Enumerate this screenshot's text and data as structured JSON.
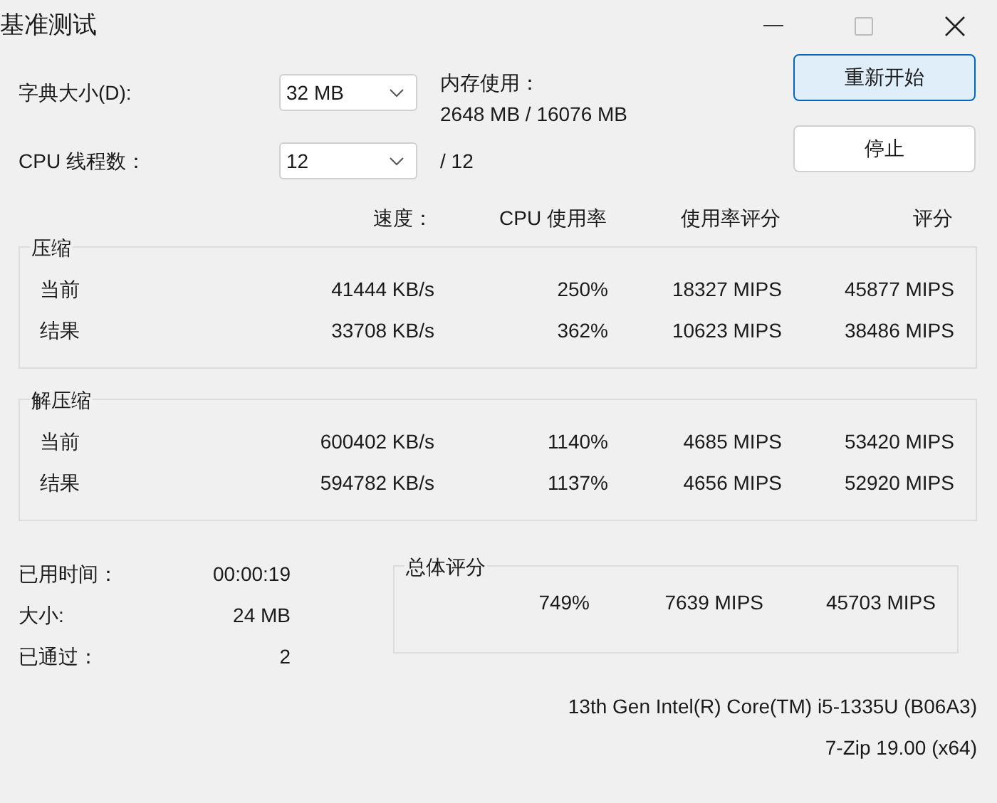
{
  "window": {
    "title": "基准测试"
  },
  "dictionary": {
    "label": "字典大小(D):",
    "value": "32 MB"
  },
  "memory": {
    "label": "内存使用：",
    "value": "2648 MB / 16076 MB"
  },
  "threads": {
    "label": "CPU 线程数：",
    "value": "12",
    "max": "/ 12"
  },
  "buttons": [
    {
      "label": "重新开始",
      "focused": true
    },
    {
      "label": "停止",
      "focused": false
    }
  ],
  "columns": [
    "速度：",
    "CPU 使用率",
    "使用率评分",
    "评分"
  ],
  "groups": [
    {
      "title": "压缩",
      "rows": [
        {
          "label": "当前",
          "cells": [
            "41444 KB/s",
            "250%",
            "18327 MIPS",
            "45877 MIPS"
          ]
        },
        {
          "label": "结果",
          "cells": [
            "33708 KB/s",
            "362%",
            "10623 MIPS",
            "38486 MIPS"
          ]
        }
      ]
    },
    {
      "title": "解压缩",
      "rows": [
        {
          "label": "当前",
          "cells": [
            "600402 KB/s",
            "1140%",
            "4685 MIPS",
            "53420 MIPS"
          ]
        },
        {
          "label": "结果",
          "cells": [
            "594782 KB/s",
            "1137%",
            "4656 MIPS",
            "52920 MIPS"
          ]
        }
      ]
    }
  ],
  "stats": [
    {
      "label": "已用时间：",
      "value": "00:00:19"
    },
    {
      "label": "大小:",
      "value": "24 MB"
    },
    {
      "label": "已通过：",
      "value": "2"
    }
  ],
  "overall": {
    "title": "总体评分",
    "cells": [
      "749%",
      "7639 MIPS",
      "45703 MIPS"
    ]
  },
  "cpu_name": "13th Gen Intel(R) Core(TM) i5-1335U (B06A3)",
  "version": "7-Zip 19.00 (x64)"
}
